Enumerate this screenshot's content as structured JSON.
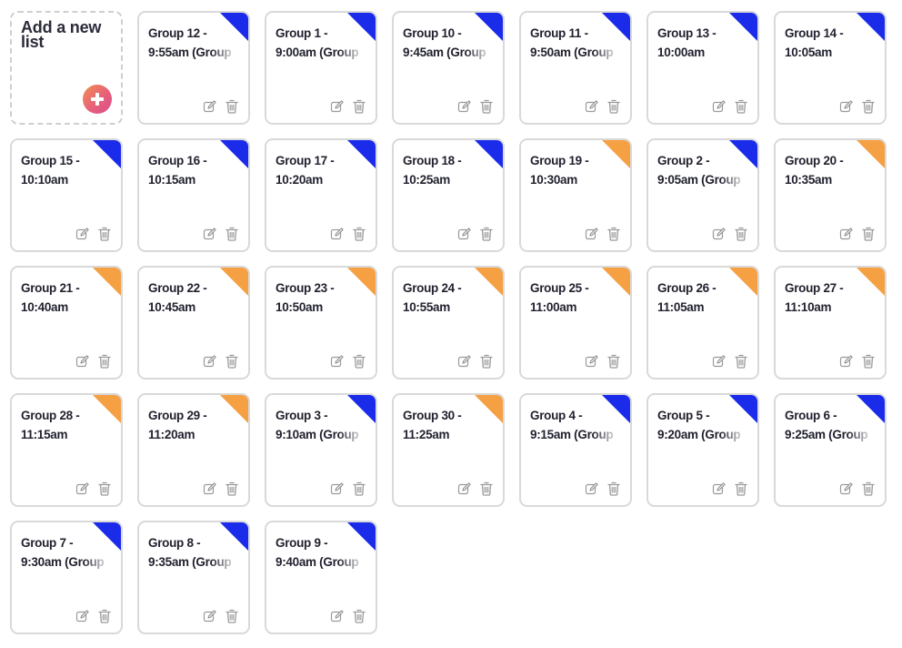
{
  "add_card": {
    "label": "Add a new list"
  },
  "colors": {
    "blue": "#1a2bea",
    "orange": "#f5a043"
  },
  "icons": {
    "edit": "edit-icon",
    "delete": "trash-icon",
    "add": "plus-icon"
  },
  "lists": [
    {
      "title": "Group 12 -\n9:55am (Group",
      "flag": "blue"
    },
    {
      "title": "Group 1 -\n9:00am (Group",
      "flag": "blue"
    },
    {
      "title": "Group 10 -\n9:45am (Group",
      "flag": "blue"
    },
    {
      "title": "Group 11 -\n9:50am (Group",
      "flag": "blue"
    },
    {
      "title": "Group 13 -\n10:00am",
      "flag": "blue"
    },
    {
      "title": "Group 14 -\n10:05am",
      "flag": "blue"
    },
    {
      "title": "Group 15 -\n10:10am",
      "flag": "blue"
    },
    {
      "title": "Group 16 -\n10:15am",
      "flag": "blue"
    },
    {
      "title": "Group 17 -\n10:20am",
      "flag": "blue"
    },
    {
      "title": "Group 18 -\n10:25am",
      "flag": "blue"
    },
    {
      "title": "Group 19 -\n10:30am",
      "flag": "orange"
    },
    {
      "title": "Group 2 -\n9:05am (Group",
      "flag": "blue"
    },
    {
      "title": "Group 20 -\n10:35am",
      "flag": "orange"
    },
    {
      "title": "Group 21 -\n10:40am",
      "flag": "orange"
    },
    {
      "title": "Group 22 -\n10:45am",
      "flag": "orange"
    },
    {
      "title": "Group 23 -\n10:50am",
      "flag": "orange"
    },
    {
      "title": "Group 24 -\n10:55am",
      "flag": "orange"
    },
    {
      "title": "Group 25 -\n11:00am",
      "flag": "orange"
    },
    {
      "title": "Group 26 -\n11:05am",
      "flag": "orange"
    },
    {
      "title": "Group 27 -\n11:10am",
      "flag": "orange"
    },
    {
      "title": "Group 28 -\n11:15am",
      "flag": "orange"
    },
    {
      "title": "Group 29 -\n11:20am",
      "flag": "orange"
    },
    {
      "title": "Group 3 -\n9:10am (Group",
      "flag": "blue"
    },
    {
      "title": "Group 30 -\n11:25am",
      "flag": "orange"
    },
    {
      "title": "Group 4 -\n9:15am (Group",
      "flag": "blue"
    },
    {
      "title": "Group 5 -\n9:20am (Group",
      "flag": "blue"
    },
    {
      "title": "Group 6 -\n9:25am (Group",
      "flag": "blue"
    },
    {
      "title": "Group 7 -\n9:30am (Group",
      "flag": "blue"
    },
    {
      "title": "Group 8 -\n9:35am (Group",
      "flag": "blue"
    },
    {
      "title": "Group 9 -\n9:40am (Group",
      "flag": "blue"
    }
  ]
}
